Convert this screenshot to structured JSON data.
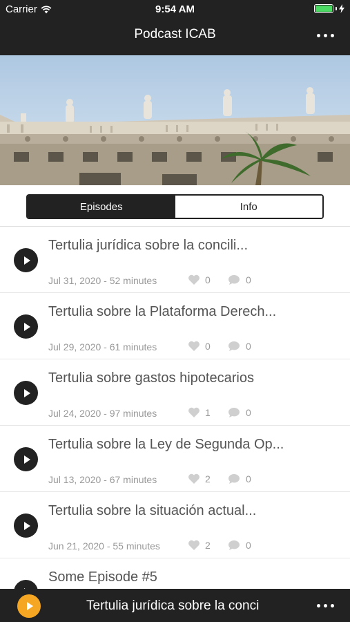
{
  "status_bar": {
    "carrier": "Carrier",
    "time": "9:54 AM",
    "battery_level": 1.0,
    "battery_color": "#4cd964"
  },
  "nav": {
    "title": "Podcast ICAB",
    "menu_icon": "more-horizontal-icon"
  },
  "tabs": [
    {
      "label": "Episodes",
      "selected": true
    },
    {
      "label": "Info",
      "selected": false
    }
  ],
  "episodes": [
    {
      "title": "Tertulia jurídica sobre la concili...",
      "meta": "Jul 31, 2020 - 52 minutes",
      "likes": "0",
      "comments": "0"
    },
    {
      "title": "Tertulia sobre la Plataforma Derech...",
      "meta": "Jul 29, 2020 - 61 minutes",
      "likes": "0",
      "comments": "0"
    },
    {
      "title": "Tertulia sobre gastos hipotecarios",
      "meta": "Jul 24, 2020 - 97 minutes",
      "likes": "1",
      "comments": "0"
    },
    {
      "title": "Tertulia sobre la Ley de Segunda Op...",
      "meta": "Jul 13, 2020 - 67 minutes",
      "likes": "2",
      "comments": "0"
    },
    {
      "title": "Tertulia sobre la situación actual...",
      "meta": "Jun 21, 2020 - 55 minutes",
      "likes": "2",
      "comments": "0"
    },
    {
      "title": "Some Episode #5",
      "meta": "",
      "likes": "",
      "comments": ""
    }
  ],
  "player": {
    "now_playing": "Tertulia jurídica sobre la conci",
    "accent_color": "#f5a623"
  },
  "colors": {
    "bar_background": "#222222",
    "text_primary": "#555555",
    "text_secondary": "#999999"
  }
}
